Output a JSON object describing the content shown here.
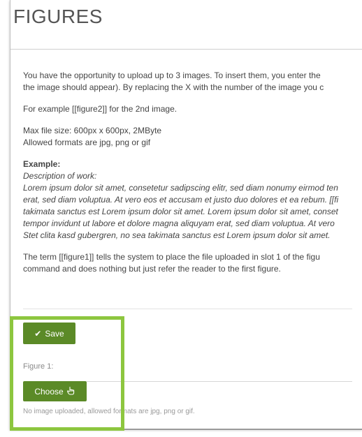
{
  "section": {
    "title": "FIGURES"
  },
  "content": {
    "intro_line1": "You have the opportunity to upload up to 3 images. To insert them, you enter the",
    "intro_line2": "the image should appear). By replacing the X with the number of the image you c",
    "example_line": "For example [[figure2]] for the 2nd image.",
    "max_size": "Max file size: 600px x 600px, 2MByte",
    "formats": "Allowed formats are jpg, png or gif",
    "example_heading": "Example:",
    "description_label": "Description of work:",
    "lorem_lines": [
      "Lorem ipsum dolor sit amet, consetetur sadipscing elitr, sed diam nonumy eirmod ten",
      "erat, sed diam voluptua. At vero eos et accusam et justo duo dolores et ea rebum. [[fi",
      "takimata sanctus est Lorem ipsum dolor sit amet. Lorem ipsum dolor sit amet, conset",
      "tempor invidunt ut labore et dolore magna aliquyam erat, sed diam voluptua. At vero",
      "Stet clita kasd gubergren, no sea takimata sanctus est Lorem ipsum dolor sit amet."
    ],
    "term_line1": "The term [[figure1]] tells the system to place the file uploaded in slot 1 of the figu",
    "term_line2": "command and does nothing but just refer the reader to the first figure."
  },
  "actions": {
    "save_label": "Save",
    "save_icon": "check-icon",
    "figure_label": "Figure 1:",
    "choose_label": "Choose",
    "choose_icon": "hand-pointer-icon",
    "upload_hint": "No image uploaded, allowed formats are jpg, png or gif."
  },
  "colors": {
    "button_green": "#5b8a27",
    "highlight_green": "#8dc63f"
  }
}
